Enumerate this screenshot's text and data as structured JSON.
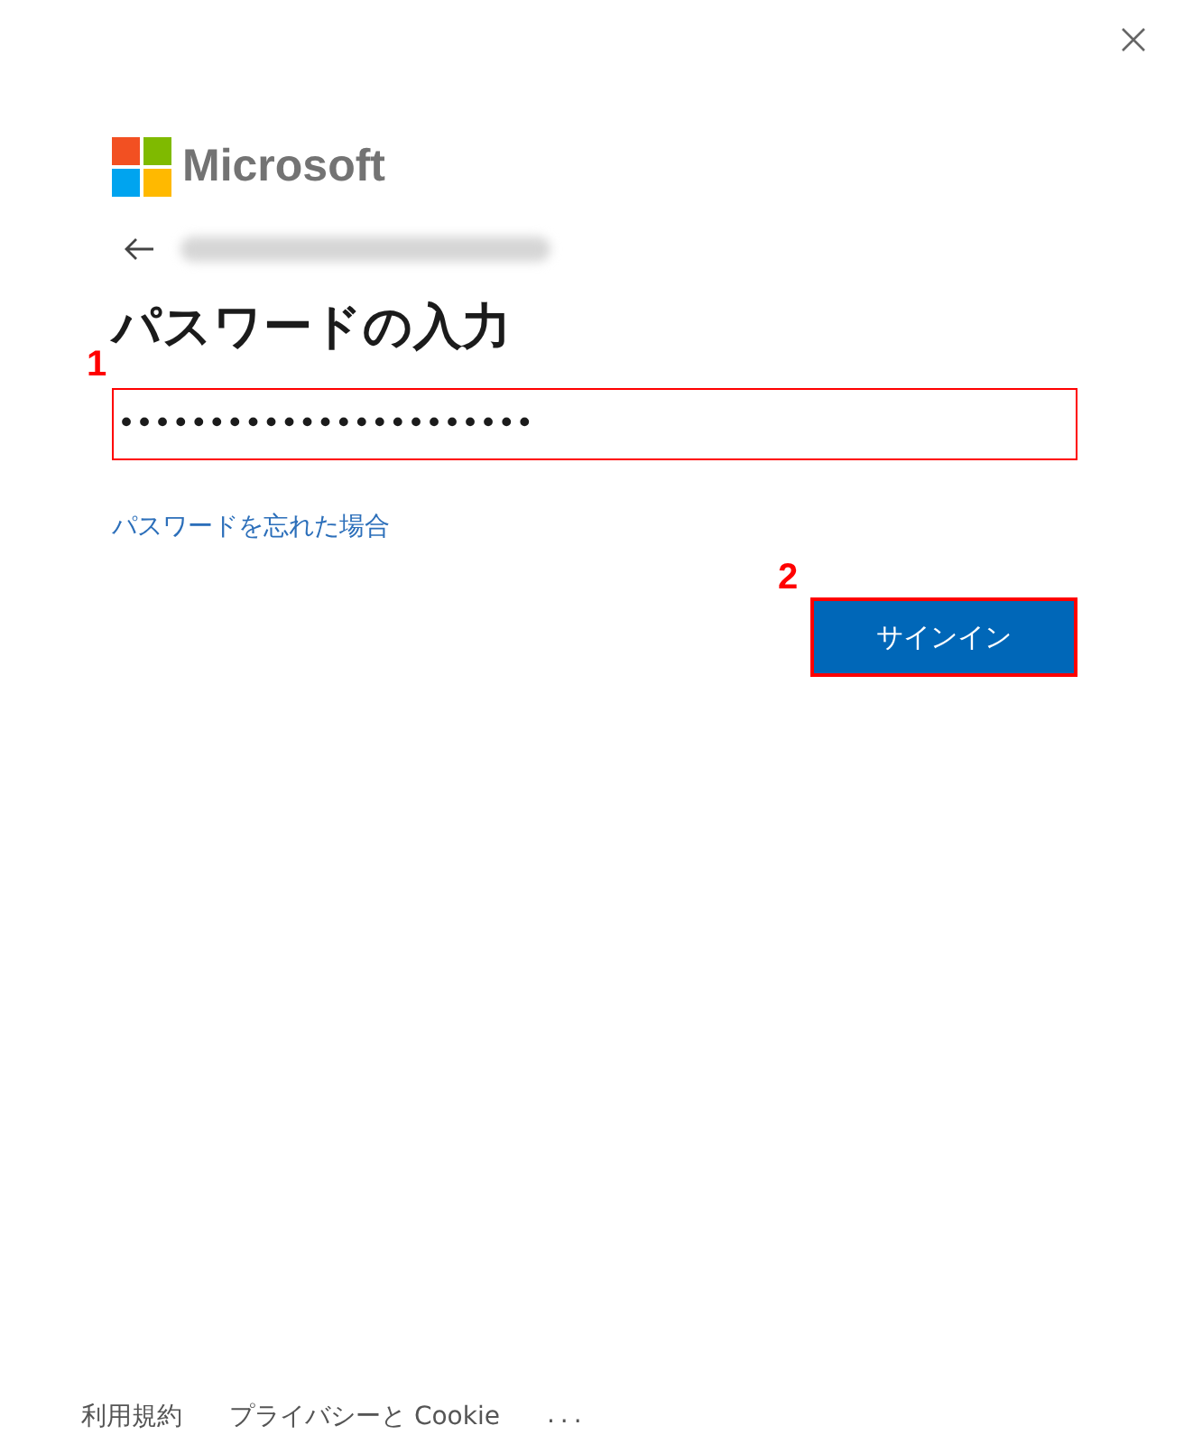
{
  "logo": {
    "text": "Microsoft"
  },
  "heading": "パスワードの入力",
  "password_field": {
    "value": "•••••••••••••••••••••••",
    "step": "1",
    "highlighted": true
  },
  "forgot_link": "パスワードを忘れた場合",
  "sign_in_button": {
    "label": "サインイン",
    "step": "2",
    "highlighted": true
  },
  "footer": [
    "利用規約",
    "プライバシーと Cookie",
    "..."
  ]
}
